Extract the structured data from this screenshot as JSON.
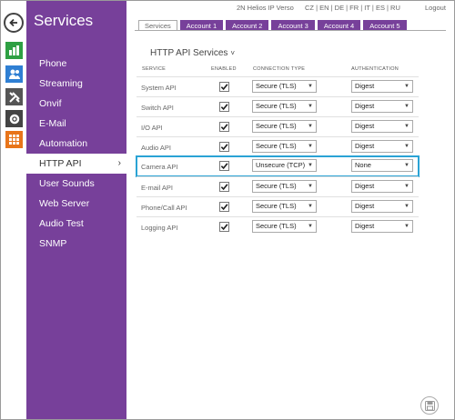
{
  "header": {
    "device": "2N Helios IP Verso",
    "languages": "CZ | EN | DE | FR | IT | ES | RU",
    "logout": "Logout"
  },
  "iconbar": {
    "back_icon": "back-arrow-icon",
    "items": [
      "status-icon",
      "directory-icon",
      "hardware-icon",
      "system-icon",
      "services-icon"
    ]
  },
  "sidebar": {
    "title": "Services",
    "items": [
      {
        "label": "Phone"
      },
      {
        "label": "Streaming"
      },
      {
        "label": "Onvif"
      },
      {
        "label": "E-Mail"
      },
      {
        "label": "Automation"
      },
      {
        "label": "HTTP API",
        "active": true
      },
      {
        "label": "User Sounds"
      },
      {
        "label": "Web Server"
      },
      {
        "label": "Audio Test"
      },
      {
        "label": "SNMP"
      }
    ]
  },
  "tabs": [
    "Services",
    "Account 1",
    "Account 2",
    "Account 3",
    "Account 4",
    "Account 5"
  ],
  "main": {
    "section_title": "HTTP API Services",
    "columns": [
      "SERVICE",
      "ENABLED",
      "CONNECTION TYPE",
      "AUTHENTICATION"
    ],
    "rows": [
      {
        "service": "System API",
        "enabled": true,
        "connection": "Secure (TLS)",
        "auth": "Digest"
      },
      {
        "service": "Switch API",
        "enabled": true,
        "connection": "Secure (TLS)",
        "auth": "Digest"
      },
      {
        "service": "I/O API",
        "enabled": true,
        "connection": "Secure (TLS)",
        "auth": "Digest"
      },
      {
        "service": "Audio API",
        "enabled": true,
        "connection": "Secure (TLS)",
        "auth": "Digest"
      },
      {
        "service": "Camera API",
        "enabled": true,
        "connection": "Unsecure (TCP)",
        "auth": "None",
        "highlight": true
      },
      {
        "service": "E-mail API",
        "enabled": true,
        "connection": "Secure (TLS)",
        "auth": "Digest"
      },
      {
        "service": "Phone/Call API",
        "enabled": true,
        "connection": "Secure (TLS)",
        "auth": "Digest"
      },
      {
        "service": "Logging API",
        "enabled": true,
        "connection": "Secure (TLS)",
        "auth": "Digest"
      }
    ]
  },
  "colors": {
    "sidebar": "#77409a",
    "highlight": "#2aa3d5"
  }
}
